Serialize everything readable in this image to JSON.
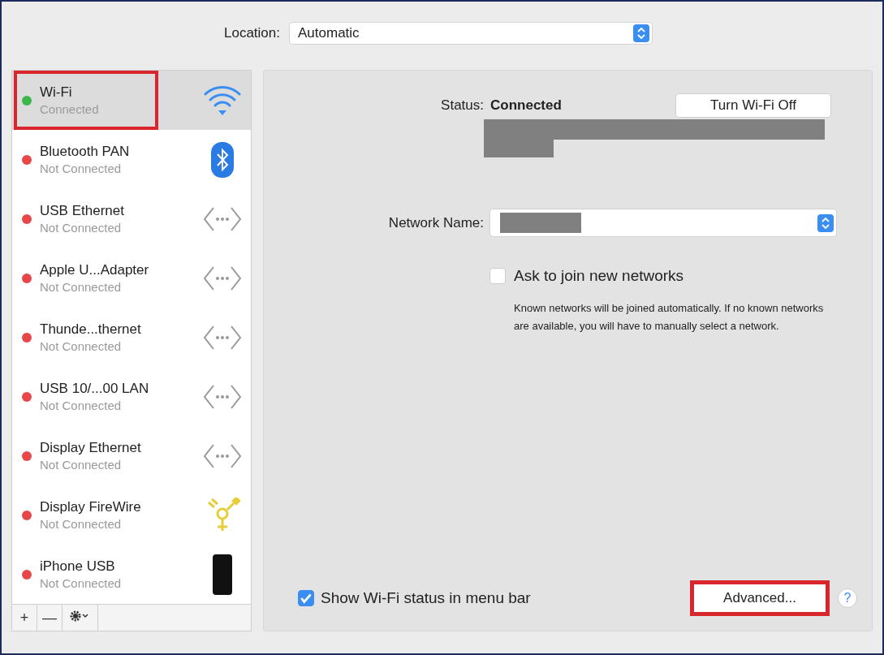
{
  "location": {
    "label": "Location:",
    "value": "Automatic"
  },
  "services": [
    {
      "name": "Wi-Fi",
      "status": "Connected",
      "color": "#3cb84a",
      "kind": "wifi",
      "selected": true,
      "highlighted": true
    },
    {
      "name": "Bluetooth PAN",
      "status": "Not Connected",
      "color": "#e8474a",
      "kind": "bluetooth",
      "selected": false,
      "highlighted": false
    },
    {
      "name": "USB Ethernet",
      "status": "Not Connected",
      "color": "#e8474a",
      "kind": "ethernet",
      "selected": false,
      "highlighted": false
    },
    {
      "name": "Apple U...Adapter",
      "status": "Not Connected",
      "color": "#e8474a",
      "kind": "ethernet",
      "selected": false,
      "highlighted": false
    },
    {
      "name": "Thunde...thernet",
      "status": "Not Connected",
      "color": "#e8474a",
      "kind": "ethernet",
      "selected": false,
      "highlighted": false
    },
    {
      "name": "USB 10/...00 LAN",
      "status": "Not Connected",
      "color": "#e8474a",
      "kind": "ethernet",
      "selected": false,
      "highlighted": false
    },
    {
      "name": "Display Ethernet",
      "status": "Not Connected",
      "color": "#e8474a",
      "kind": "ethernet",
      "selected": false,
      "highlighted": false
    },
    {
      "name": "Display FireWire",
      "status": "Not Connected",
      "color": "#e8474a",
      "kind": "firewire",
      "selected": false,
      "highlighted": false
    },
    {
      "name": "iPhone USB",
      "status": "Not Connected",
      "color": "#e8474a",
      "kind": "phone",
      "selected": false,
      "highlighted": false
    }
  ],
  "toolbar": {
    "add": "+",
    "remove": "—"
  },
  "status": {
    "label": "Status:",
    "value": "Connected",
    "button": "Turn Wi-Fi Off"
  },
  "network_name": {
    "label": "Network Name:"
  },
  "ask_join": {
    "label": "Ask to join new networks",
    "checked": false,
    "note": "Known networks will be joined automatically. If no known networks are available, you will have to manually select a network."
  },
  "show_status": {
    "label": "Show Wi-Fi status in menu bar",
    "checked": true
  },
  "advanced": {
    "label": "Advanced...",
    "highlighted": true
  },
  "help": "?"
}
